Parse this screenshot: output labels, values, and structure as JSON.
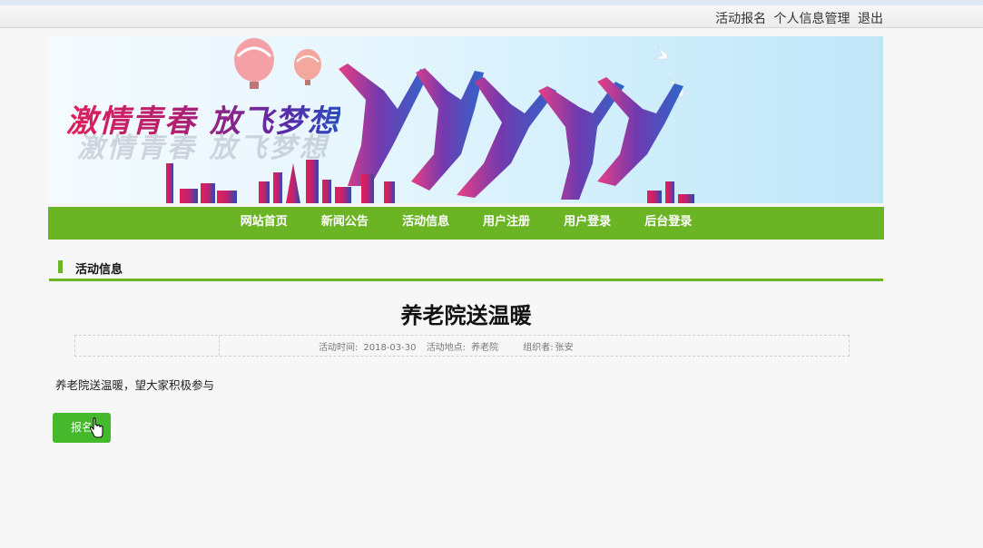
{
  "topbar": {
    "links": [
      "活动报名",
      "个人信息管理",
      "退出"
    ]
  },
  "banner": {
    "slogan": "激情青春 放飞梦想"
  },
  "nav": {
    "items": [
      "网站首页",
      "新闻公告",
      "活动信息",
      "用户注册",
      "用户登录",
      "后台登录"
    ]
  },
  "section": {
    "title": "活动信息"
  },
  "article": {
    "title": "养老院送温暖",
    "meta": {
      "time_label": "活动时间:",
      "time_value": "2018-03-30",
      "place_label": "活动地点:",
      "place_value": "养老院",
      "organizer_label": "组织者:",
      "organizer_value": "张安"
    },
    "content": "养老院送温暖，望大家积极参与",
    "signup_label": "报名"
  },
  "colors": {
    "accent": "#6bb525",
    "button": "#46b82c"
  }
}
